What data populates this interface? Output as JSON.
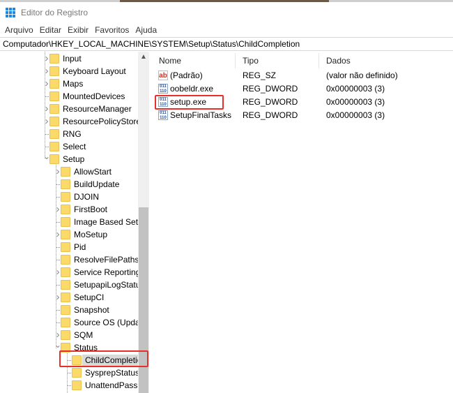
{
  "window": {
    "title": "Editor do Registro"
  },
  "menu": [
    "Arquivo",
    "Editar",
    "Exibir",
    "Favoritos",
    "Ajuda"
  ],
  "address": "Computador\\HKEY_LOCAL_MACHINE\\SYSTEM\\Setup\\Status\\ChildCompletion",
  "tree": [
    {
      "label": "Input",
      "level": 1,
      "exp": "closed"
    },
    {
      "label": "Keyboard Layout",
      "level": 1,
      "exp": "closed"
    },
    {
      "label": "Maps",
      "level": 1,
      "exp": "closed"
    },
    {
      "label": "MountedDevices",
      "level": 1,
      "exp": "none"
    },
    {
      "label": "ResourceManager",
      "level": 1,
      "exp": "closed"
    },
    {
      "label": "ResourcePolicyStore",
      "level": 1,
      "exp": "closed"
    },
    {
      "label": "RNG",
      "level": 1,
      "exp": "none"
    },
    {
      "label": "Select",
      "level": 1,
      "exp": "none"
    },
    {
      "label": "Setup",
      "level": 1,
      "exp": "open"
    },
    {
      "label": "AllowStart",
      "level": 2,
      "exp": "closed"
    },
    {
      "label": "BuildUpdate",
      "level": 2,
      "exp": "none"
    },
    {
      "label": "DJOIN",
      "level": 2,
      "exp": "none"
    },
    {
      "label": "FirstBoot",
      "level": 2,
      "exp": "closed"
    },
    {
      "label": "Image Based Setup",
      "level": 2,
      "exp": "none"
    },
    {
      "label": "MoSetup",
      "level": 2,
      "exp": "closed"
    },
    {
      "label": "Pid",
      "level": 2,
      "exp": "none"
    },
    {
      "label": "ResolveFilePaths",
      "level": 2,
      "exp": "none"
    },
    {
      "label": "Service Reporting",
      "level": 2,
      "exp": "closed"
    },
    {
      "label": "SetupapiLogStatus",
      "level": 2,
      "exp": "none"
    },
    {
      "label": "SetupCI",
      "level": 2,
      "exp": "closed"
    },
    {
      "label": "Snapshot",
      "level": 2,
      "exp": "none"
    },
    {
      "label": "Source OS (Updated)",
      "level": 2,
      "exp": "none"
    },
    {
      "label": "SQM",
      "level": 2,
      "exp": "closed"
    },
    {
      "label": "Status",
      "level": 2,
      "exp": "open"
    },
    {
      "label": "ChildCompletion",
      "level": 3,
      "exp": "none",
      "selected": true
    },
    {
      "label": "SysprepStatus",
      "level": 3,
      "exp": "none"
    },
    {
      "label": "UnattendPasses",
      "level": 3,
      "exp": "none"
    }
  ],
  "columns": [
    "Nome",
    "Tipo",
    "Dados"
  ],
  "values": [
    {
      "icon": "string-value-icon",
      "icon_text": "ab",
      "name": "(Padrão)",
      "type": "REG_SZ",
      "data": "(valor não definido)"
    },
    {
      "icon": "binary-value-icon",
      "icon_text": "011\n110",
      "name": "oobeldr.exe",
      "type": "REG_DWORD",
      "data": "0x00000003 (3)"
    },
    {
      "icon": "binary-value-icon",
      "icon_text": "011\n110",
      "name": "setup.exe",
      "type": "REG_DWORD",
      "data": "0x00000003 (3)",
      "highlighted": true
    },
    {
      "icon": "binary-value-icon",
      "icon_text": "011\n110",
      "name": "SetupFinalTasks",
      "type": "REG_DWORD",
      "data": "0x00000003 (3)"
    }
  ],
  "colors": {
    "highlight": "#e8302a",
    "folder": "#fbd96a",
    "accent": "#1e88e5"
  }
}
